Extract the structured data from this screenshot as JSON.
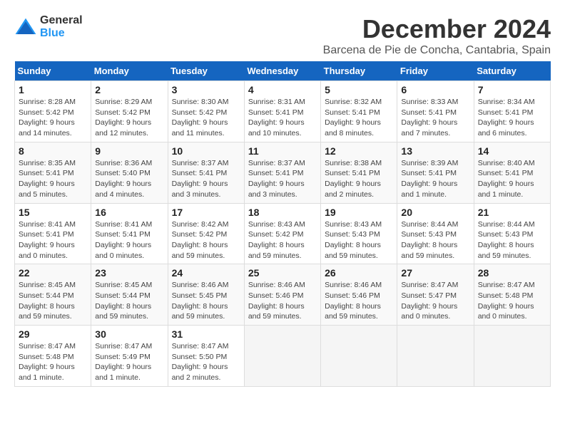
{
  "header": {
    "logo_general": "General",
    "logo_blue": "Blue",
    "month": "December 2024",
    "location": "Barcena de Pie de Concha, Cantabria, Spain"
  },
  "days_of_week": [
    "Sunday",
    "Monday",
    "Tuesday",
    "Wednesday",
    "Thursday",
    "Friday",
    "Saturday"
  ],
  "weeks": [
    [
      {
        "day": "1",
        "sunrise": "8:28 AM",
        "sunset": "5:42 PM",
        "daylight": "9 hours and 14 minutes."
      },
      {
        "day": "2",
        "sunrise": "8:29 AM",
        "sunset": "5:42 PM",
        "daylight": "9 hours and 12 minutes."
      },
      {
        "day": "3",
        "sunrise": "8:30 AM",
        "sunset": "5:42 PM",
        "daylight": "9 hours and 11 minutes."
      },
      {
        "day": "4",
        "sunrise": "8:31 AM",
        "sunset": "5:41 PM",
        "daylight": "9 hours and 10 minutes."
      },
      {
        "day": "5",
        "sunrise": "8:32 AM",
        "sunset": "5:41 PM",
        "daylight": "9 hours and 8 minutes."
      },
      {
        "day": "6",
        "sunrise": "8:33 AM",
        "sunset": "5:41 PM",
        "daylight": "9 hours and 7 minutes."
      },
      {
        "day": "7",
        "sunrise": "8:34 AM",
        "sunset": "5:41 PM",
        "daylight": "9 hours and 6 minutes."
      }
    ],
    [
      {
        "day": "8",
        "sunrise": "8:35 AM",
        "sunset": "5:41 PM",
        "daylight": "9 hours and 5 minutes."
      },
      {
        "day": "9",
        "sunrise": "8:36 AM",
        "sunset": "5:40 PM",
        "daylight": "9 hours and 4 minutes."
      },
      {
        "day": "10",
        "sunrise": "8:37 AM",
        "sunset": "5:41 PM",
        "daylight": "9 hours and 3 minutes."
      },
      {
        "day": "11",
        "sunrise": "8:37 AM",
        "sunset": "5:41 PM",
        "daylight": "9 hours and 3 minutes."
      },
      {
        "day": "12",
        "sunrise": "8:38 AM",
        "sunset": "5:41 PM",
        "daylight": "9 hours and 2 minutes."
      },
      {
        "day": "13",
        "sunrise": "8:39 AM",
        "sunset": "5:41 PM",
        "daylight": "9 hours and 1 minute."
      },
      {
        "day": "14",
        "sunrise": "8:40 AM",
        "sunset": "5:41 PM",
        "daylight": "9 hours and 1 minute."
      }
    ],
    [
      {
        "day": "15",
        "sunrise": "8:41 AM",
        "sunset": "5:41 PM",
        "daylight": "9 hours and 0 minutes."
      },
      {
        "day": "16",
        "sunrise": "8:41 AM",
        "sunset": "5:41 PM",
        "daylight": "9 hours and 0 minutes."
      },
      {
        "day": "17",
        "sunrise": "8:42 AM",
        "sunset": "5:42 PM",
        "daylight": "8 hours and 59 minutes."
      },
      {
        "day": "18",
        "sunrise": "8:43 AM",
        "sunset": "5:42 PM",
        "daylight": "8 hours and 59 minutes."
      },
      {
        "day": "19",
        "sunrise": "8:43 AM",
        "sunset": "5:43 PM",
        "daylight": "8 hours and 59 minutes."
      },
      {
        "day": "20",
        "sunrise": "8:44 AM",
        "sunset": "5:43 PM",
        "daylight": "8 hours and 59 minutes."
      },
      {
        "day": "21",
        "sunrise": "8:44 AM",
        "sunset": "5:43 PM",
        "daylight": "8 hours and 59 minutes."
      }
    ],
    [
      {
        "day": "22",
        "sunrise": "8:45 AM",
        "sunset": "5:44 PM",
        "daylight": "8 hours and 59 minutes."
      },
      {
        "day": "23",
        "sunrise": "8:45 AM",
        "sunset": "5:44 PM",
        "daylight": "8 hours and 59 minutes."
      },
      {
        "day": "24",
        "sunrise": "8:46 AM",
        "sunset": "5:45 PM",
        "daylight": "8 hours and 59 minutes."
      },
      {
        "day": "25",
        "sunrise": "8:46 AM",
        "sunset": "5:46 PM",
        "daylight": "8 hours and 59 minutes."
      },
      {
        "day": "26",
        "sunrise": "8:46 AM",
        "sunset": "5:46 PM",
        "daylight": "8 hours and 59 minutes."
      },
      {
        "day": "27",
        "sunrise": "8:47 AM",
        "sunset": "5:47 PM",
        "daylight": "9 hours and 0 minutes."
      },
      {
        "day": "28",
        "sunrise": "8:47 AM",
        "sunset": "5:48 PM",
        "daylight": "9 hours and 0 minutes."
      }
    ],
    [
      {
        "day": "29",
        "sunrise": "8:47 AM",
        "sunset": "5:48 PM",
        "daylight": "9 hours and 1 minute."
      },
      {
        "day": "30",
        "sunrise": "8:47 AM",
        "sunset": "5:49 PM",
        "daylight": "9 hours and 1 minute."
      },
      {
        "day": "31",
        "sunrise": "8:47 AM",
        "sunset": "5:50 PM",
        "daylight": "9 hours and 2 minutes."
      },
      null,
      null,
      null,
      null
    ]
  ]
}
